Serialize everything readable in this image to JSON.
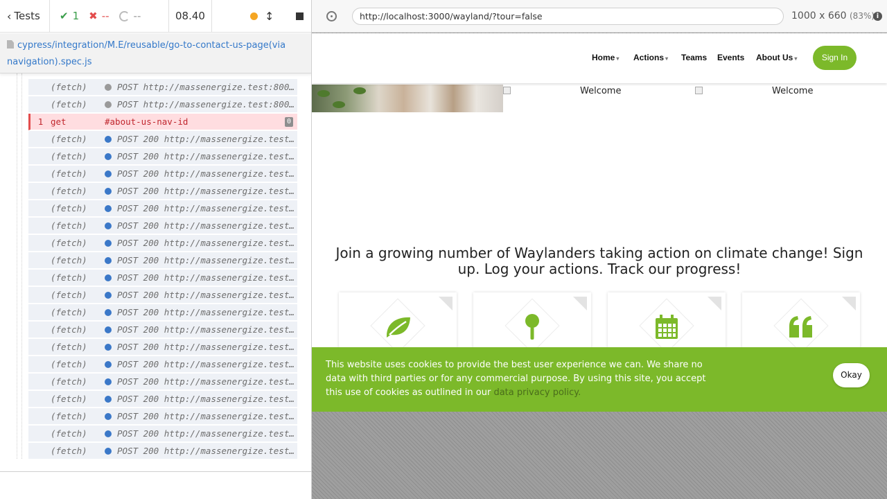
{
  "reporter": {
    "tests_label": "Tests",
    "passed_count": "1",
    "failed_count": "--",
    "pending_count": "--",
    "duration": "08.40",
    "spec_path": "cypress/integration/M.E/reusable/go-to-contact-us-page(via navigation).spec.js",
    "commands": [
      {
        "num": "",
        "method": "(fetch)",
        "dot": "grey",
        "message": "POST http://massenergize.test:800…",
        "failed": false
      },
      {
        "num": "",
        "method": "(fetch)",
        "dot": "grey",
        "message": "POST http://massenergize.test:800…",
        "failed": false
      },
      {
        "num": "1",
        "method": "get",
        "dot": "",
        "message": "#about-us-nav-id",
        "failed": true,
        "badge": "0"
      },
      {
        "num": "",
        "method": "(fetch)",
        "dot": "blue",
        "message": "POST 200 http://massenergize.test…",
        "failed": false
      },
      {
        "num": "",
        "method": "(fetch)",
        "dot": "blue",
        "message": "POST 200 http://massenergize.test…",
        "failed": false
      },
      {
        "num": "",
        "method": "(fetch)",
        "dot": "blue",
        "message": "POST 200 http://massenergize.test…",
        "failed": false
      },
      {
        "num": "",
        "method": "(fetch)",
        "dot": "blue",
        "message": "POST 200 http://massenergize.test…",
        "failed": false
      },
      {
        "num": "",
        "method": "(fetch)",
        "dot": "blue",
        "message": "POST 200 http://massenergize.test…",
        "failed": false
      },
      {
        "num": "",
        "method": "(fetch)",
        "dot": "blue",
        "message": "POST 200 http://massenergize.test…",
        "failed": false
      },
      {
        "num": "",
        "method": "(fetch)",
        "dot": "blue",
        "message": "POST 200 http://massenergize.test…",
        "failed": false
      },
      {
        "num": "",
        "method": "(fetch)",
        "dot": "blue",
        "message": "POST 200 http://massenergize.test…",
        "failed": false
      },
      {
        "num": "",
        "method": "(fetch)",
        "dot": "blue",
        "message": "POST 200 http://massenergize.test…",
        "failed": false
      },
      {
        "num": "",
        "method": "(fetch)",
        "dot": "blue",
        "message": "POST 200 http://massenergize.test…",
        "failed": false
      },
      {
        "num": "",
        "method": "(fetch)",
        "dot": "blue",
        "message": "POST 200 http://massenergize.test…",
        "failed": false
      },
      {
        "num": "",
        "method": "(fetch)",
        "dot": "blue",
        "message": "POST 200 http://massenergize.test…",
        "failed": false
      },
      {
        "num": "",
        "method": "(fetch)",
        "dot": "blue",
        "message": "POST 200 http://massenergize.test…",
        "failed": false
      },
      {
        "num": "",
        "method": "(fetch)",
        "dot": "blue",
        "message": "POST 200 http://massenergize.test…",
        "failed": false
      },
      {
        "num": "",
        "method": "(fetch)",
        "dot": "blue",
        "message": "POST 200 http://massenergize.test…",
        "failed": false
      },
      {
        "num": "",
        "method": "(fetch)",
        "dot": "blue",
        "message": "POST 200 http://massenergize.test…",
        "failed": false
      },
      {
        "num": "",
        "method": "(fetch)",
        "dot": "blue",
        "message": "POST 200 http://massenergize.test…",
        "failed": false
      },
      {
        "num": "",
        "method": "(fetch)",
        "dot": "blue",
        "message": "POST 200 http://massenergize.test…",
        "failed": false
      },
      {
        "num": "",
        "method": "(fetch)",
        "dot": "blue",
        "message": "POST 200 http://massenergize.test…",
        "failed": false
      }
    ]
  },
  "aut": {
    "url": "http://localhost:3000/wayland/?tour=false",
    "viewport_size": "1000 x 660",
    "zoom": "(83%)"
  },
  "site": {
    "nav": [
      {
        "label": "Home",
        "has_caret": true
      },
      {
        "label": "Actions",
        "has_caret": true
      },
      {
        "label": "Teams",
        "has_caret": false
      },
      {
        "label": "Events",
        "has_caret": false
      },
      {
        "label": "About Us",
        "has_caret": true
      }
    ],
    "signin_label": "Sign In",
    "welcome_alt_1": "Welcome",
    "welcome_alt_2": "Welcome",
    "headline": "Join a growing number of Waylanders taking action on climate change! Sign up. Log your actions. Track our progress!",
    "cards": [
      {
        "icon": "leaf-icon"
      },
      {
        "icon": "pin-icon"
      },
      {
        "icon": "calendar-icon"
      },
      {
        "icon": "quote-icon"
      }
    ],
    "cookie": {
      "text": "This website uses cookies to provide the best user experience we can. We share no data with third parties or for any commercial purpose. By using this site, you accept this use of cookies as outlined in our",
      "link": "data privacy policy.",
      "button": "Okay"
    }
  },
  "colors": {
    "brand_green": "#7cb92a",
    "cypress_blue": "#3378c9",
    "failed_red": "#e34d4d"
  }
}
